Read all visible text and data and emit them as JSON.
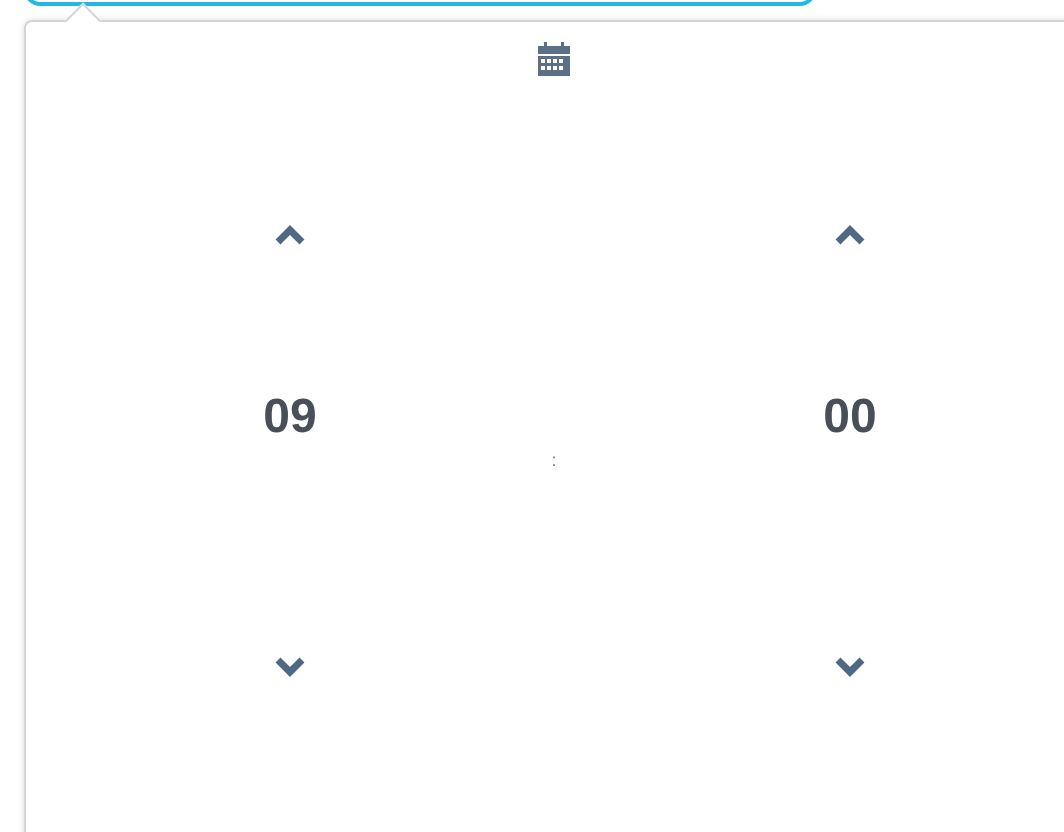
{
  "picker": {
    "hours": "09",
    "separator": ":",
    "minutes": "00"
  }
}
